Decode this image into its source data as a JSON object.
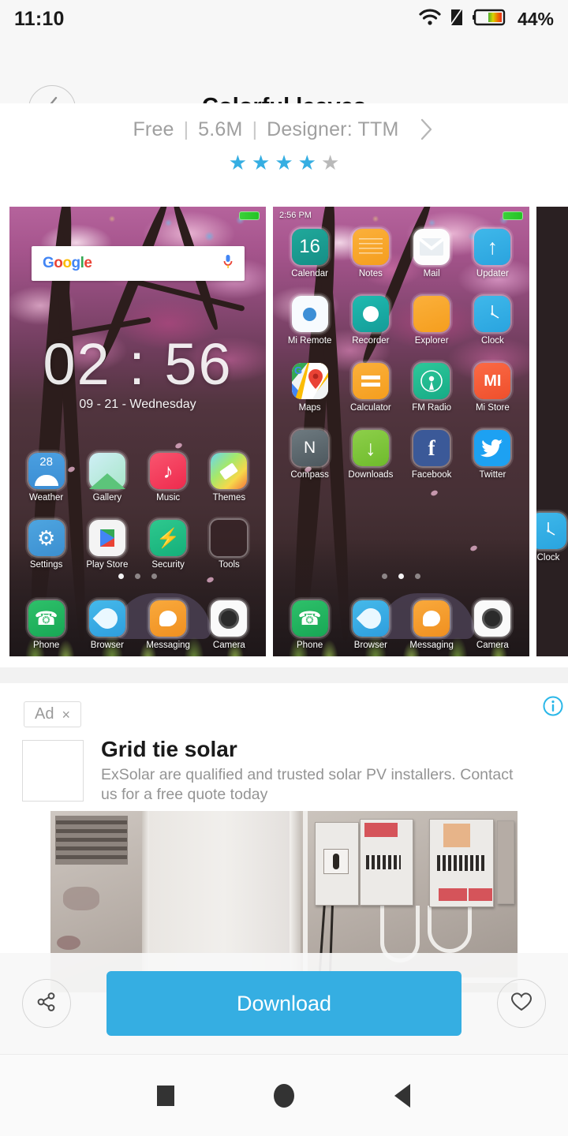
{
  "status_bar": {
    "time": "11:10",
    "battery_percent": "44%",
    "icons": [
      "wifi-icon",
      "sim-off-icon",
      "battery-icon"
    ]
  },
  "header": {
    "title": "Colorful leaves",
    "back_icon": "chevron-left-icon"
  },
  "theme_info": {
    "price": "Free",
    "size": "5.6M",
    "designer": "Designer: TTM",
    "separator": "|",
    "chevron_icon": "chevron-right-icon",
    "rating": 4,
    "rating_max": 5,
    "star_glyph": "★",
    "star_active_color": "#35aee2",
    "star_inactive_color": "#b9b9b9"
  },
  "previews": [
    {
      "type": "lockscreen",
      "status_time": "",
      "search_widget": {
        "logo": "Google",
        "mic_icon": "microphone-icon"
      },
      "clock": "02 : 56",
      "date": "09 - 21 - Wednesday",
      "page_dots": {
        "count": 3,
        "active": 0
      },
      "rows": [
        [
          {
            "label": "Weather",
            "icon": "weather-icon",
            "badge": "28"
          },
          {
            "label": "Gallery",
            "icon": "gallery-icon"
          },
          {
            "label": "Music",
            "icon": "music-icon"
          },
          {
            "label": "Themes",
            "icon": "themes-icon"
          }
        ],
        [
          {
            "label": "Settings",
            "icon": "settings-gear-icon"
          },
          {
            "label": "Play Store",
            "icon": "play-store-icon"
          },
          {
            "label": "Security",
            "icon": "security-shield-icon"
          },
          {
            "label": "Tools",
            "icon": "folder-tools-icon"
          }
        ]
      ],
      "dock": [
        {
          "label": "Phone",
          "icon": "phone-icon"
        },
        {
          "label": "Browser",
          "icon": "browser-icon"
        },
        {
          "label": "Messaging",
          "icon": "messaging-icon"
        },
        {
          "label": "Camera",
          "icon": "camera-icon"
        }
      ]
    },
    {
      "type": "homescreen",
      "status_time": "2:56 PM",
      "page_dots": {
        "count": 3,
        "active": 1
      },
      "rows": [
        [
          {
            "label": "Calendar",
            "icon": "calendar-icon",
            "day": "16"
          },
          {
            "label": "Notes",
            "icon": "notes-icon"
          },
          {
            "label": "Mail",
            "icon": "mail-icon"
          },
          {
            "label": "Updater",
            "icon": "updater-arrow-icon"
          }
        ],
        [
          {
            "label": "Mi Remote",
            "icon": "mi-remote-icon"
          },
          {
            "label": "Recorder",
            "icon": "recorder-icon"
          },
          {
            "label": "Explorer",
            "icon": "explorer-icon"
          },
          {
            "label": "Clock",
            "icon": "clock-icon"
          }
        ],
        [
          {
            "label": "Maps",
            "icon": "maps-icon"
          },
          {
            "label": "Calculator",
            "icon": "calculator-icon"
          },
          {
            "label": "FM Radio",
            "icon": "fm-radio-icon"
          },
          {
            "label": "Mi Store",
            "icon": "mi-store-icon"
          }
        ],
        [
          {
            "label": "Compass",
            "icon": "compass-icon"
          },
          {
            "label": "Downloads",
            "icon": "downloads-icon"
          },
          {
            "label": "Facebook",
            "icon": "facebook-icon"
          },
          {
            "label": "Twitter",
            "icon": "twitter-icon"
          }
        ]
      ],
      "dock": [
        {
          "label": "Phone",
          "icon": "phone-icon"
        },
        {
          "label": "Browser",
          "icon": "browser-icon"
        },
        {
          "label": "Messaging",
          "icon": "messaging-icon"
        },
        {
          "label": "Camera",
          "icon": "camera-icon"
        }
      ]
    },
    {
      "type": "dark-partial",
      "apps": [
        {
          "label": "Clock",
          "icon": "clock-icon"
        }
      ]
    }
  ],
  "ad": {
    "badge_label": "Ad",
    "close_glyph": "×",
    "info_icon": "info-circle-icon",
    "thumbnail": "ad-thumbnail-placeholder",
    "title": "Grid tie solar",
    "description": "ExSolar are qualified and trusted solar PV installers. Contact us for a free quote today",
    "image": "electrical-panel-photo"
  },
  "action_bar": {
    "share_icon": "share-icon",
    "download_label": "Download",
    "favorite_icon": "heart-icon",
    "accent_color": "#35aee2"
  },
  "nav_bar": {
    "recents_icon": "square-recents-icon",
    "home_icon": "circle-home-icon",
    "back_icon": "triangle-back-icon"
  }
}
